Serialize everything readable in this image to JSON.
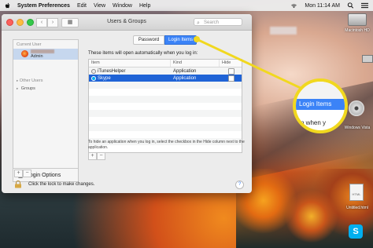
{
  "menubar": {
    "app_name": "System Preferences",
    "menus": [
      "Edit",
      "View",
      "Window",
      "Help"
    ],
    "clock": "Mon 11:14 AM"
  },
  "window": {
    "title": "Users & Groups",
    "search_placeholder": "Search",
    "nav_back": "‹",
    "nav_forward": "›",
    "grid_glyph": "▦"
  },
  "sidebar": {
    "current_user_label": "Current User",
    "current_user_role": "Admin",
    "other_users_label": "Other Users",
    "groups_label": "Groups",
    "login_options_label": "Login Options"
  },
  "tabs": [
    {
      "label": "Password",
      "selected": false
    },
    {
      "label": "Login Items",
      "selected": true
    }
  ],
  "intro_text": "These items will open automatically when you log in:",
  "table": {
    "headers": [
      "Item",
      "Kind",
      "Hide"
    ],
    "rows": [
      {
        "icon": "itunes-helper-icon",
        "item": "iTunesHelper",
        "kind": "Application",
        "hide": false,
        "selected": false
      },
      {
        "icon": "skype-icon",
        "item": "Skype",
        "kind": "Application",
        "hide": false,
        "selected": true
      }
    ]
  },
  "hint_text": "To hide an application when you log in, select the checkbox in the Hide column next to the application.",
  "buttons": {
    "plus": "+",
    "minus": "−",
    "help": "?"
  },
  "lock_text": "Click the lock to make changes.",
  "callout": {
    "label": "Login Items",
    "underneath_text": "n when y"
  },
  "desktop": {
    "drive_label": "Macintosh HD",
    "dvd_label": "Windows Vista",
    "doc_label": "Untitled.html",
    "doc_type": "HTML",
    "skype_glyph": "S"
  },
  "colors": {
    "accent": "#3b83f7",
    "selected_row": "#1f63d6",
    "callout_yellow": "#f1d81f"
  }
}
